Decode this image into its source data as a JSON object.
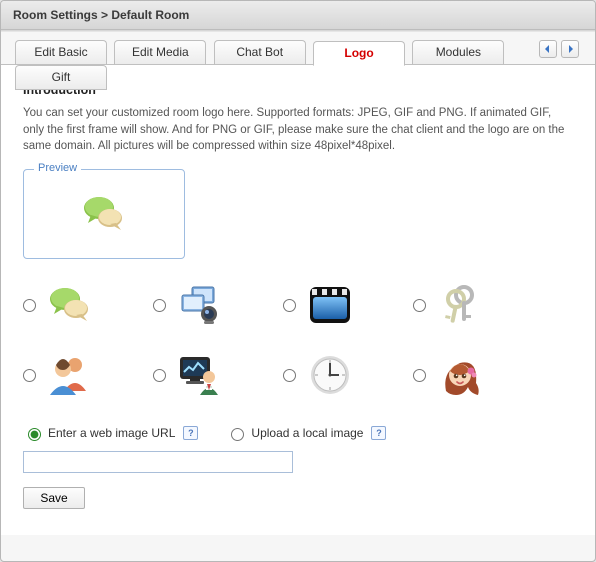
{
  "header": {
    "breadcrumb": "Room Settings  >  Default Room"
  },
  "tabs": {
    "items": [
      {
        "label": "Edit Basic",
        "active": false
      },
      {
        "label": "Edit Media",
        "active": false
      },
      {
        "label": "Chat Bot",
        "active": false
      },
      {
        "label": "Logo",
        "active": true
      },
      {
        "label": "Modules",
        "active": false
      },
      {
        "label": "Gift",
        "active": false
      }
    ]
  },
  "intro": {
    "heading": "Introduction",
    "body": "You can set your customized room logo here. Supported formats: JPEG, GIF and PNG. If animated GIF, only the first frame will show. And for PNG or GIF, please make sure the chat client and the logo are on the same domain. All pictures will be compressed within size 48pixel*48pixel."
  },
  "preview": {
    "legend": "Preview",
    "selected_logo": "chat-bubbles-icon"
  },
  "logo_options": [
    {
      "name": "chat-bubbles-icon"
    },
    {
      "name": "webcam-icon"
    },
    {
      "name": "video-clapper-icon"
    },
    {
      "name": "keys-icon"
    },
    {
      "name": "people-icon"
    },
    {
      "name": "monitor-analytics-icon"
    },
    {
      "name": "clock-icon"
    },
    {
      "name": "avatar-girl-icon"
    }
  ],
  "upload": {
    "option_url_label": "Enter a web image URL",
    "option_file_label": "Upload a local image",
    "selected": "url",
    "url_value": ""
  },
  "buttons": {
    "save": "Save"
  },
  "help_glyph": "?"
}
